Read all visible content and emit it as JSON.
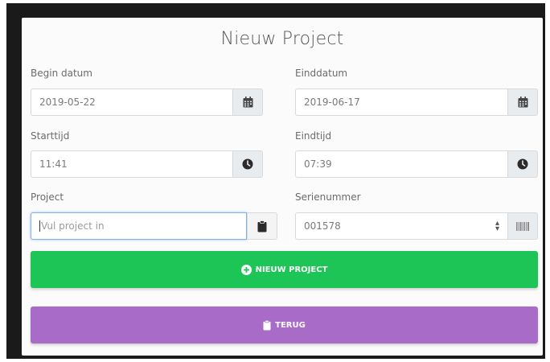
{
  "modal": {
    "title": "Nieuw Project"
  },
  "form": {
    "begin_date": {
      "label": "Begin datum",
      "value": "2019-05-22",
      "icon": "calendar-icon"
    },
    "end_date": {
      "label": "Einddatum",
      "value": "2019-06-17",
      "icon": "calendar-icon"
    },
    "start_time": {
      "label": "Starttijd",
      "value": "11:41",
      "icon": "clock-icon"
    },
    "end_time": {
      "label": "Eindtijd",
      "value": "07:39",
      "icon": "clock-icon"
    },
    "project": {
      "label": "Project",
      "placeholder": "Vul project in",
      "icon": "clipboard-icon"
    },
    "serial": {
      "label": "Serienummer",
      "value": "001578",
      "icon": "barcode-icon"
    }
  },
  "buttons": {
    "new_project": {
      "label": "NIEUW PROJECT",
      "icon": "plus-circle-icon",
      "color": "#1dc456"
    },
    "back": {
      "label": "TERUG",
      "icon": "clipboard-icon",
      "color": "#a86cc8"
    }
  },
  "colors": {
    "focus_border": "#7fb2e8",
    "addon_background": "#e9ecef"
  }
}
